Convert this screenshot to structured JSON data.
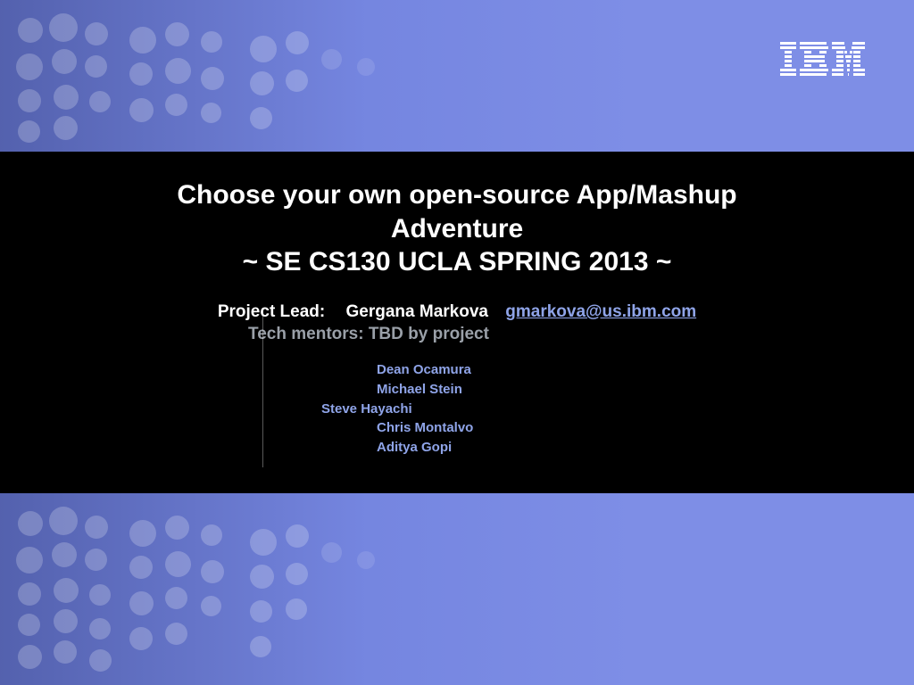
{
  "logo_text": "IBM",
  "title_line1": "Choose your own open-source App/Mashup Adventure",
  "subtitle": "~ SE CS130 UCLA SPRING 2013 ~",
  "lead_label": "Project Lead:",
  "lead_name": "Gergana Markova",
  "lead_email": "gmarkova@us.ibm.com",
  "mentors": "Tech mentors: TBD by project",
  "names": {
    "n1": "Dean Ocamura",
    "n2": "Michael Stein",
    "n3": "Steve Hayachi",
    "n4": "Chris Montalvo",
    "n5": "Aditya Gopi"
  }
}
